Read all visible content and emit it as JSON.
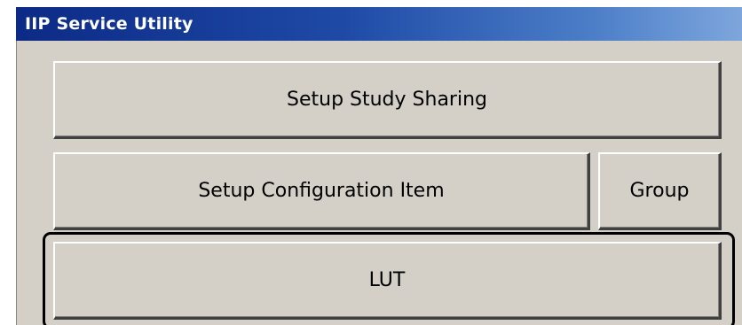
{
  "window": {
    "title": "IIP Service Utility"
  },
  "buttons": {
    "setup_study_sharing": "Setup Study Sharing",
    "setup_configuration_item": "Setup Configuration Item",
    "group": "Group",
    "lut": "LUT"
  },
  "colors": {
    "titlebar_start": "#0c2a86",
    "titlebar_end": "#7ea6dc",
    "panel_background": "#d4d0c8",
    "focus_highlight": "#000000"
  },
  "focused_button": "lut"
}
